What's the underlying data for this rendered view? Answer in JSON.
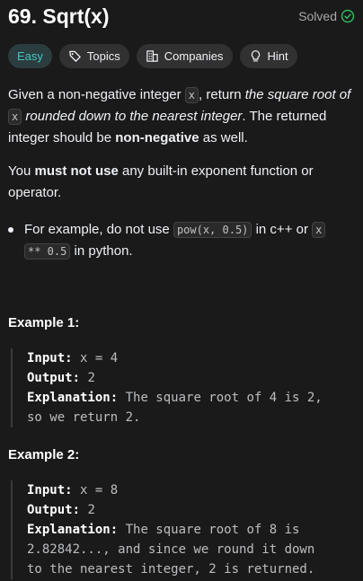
{
  "problem": {
    "title": "69. Sqrt(x)",
    "status": "Solved"
  },
  "tags": {
    "difficulty": "Easy",
    "topics": "Topics",
    "companies": "Companies",
    "hint": "Hint"
  },
  "description": {
    "p1_a": "Given a non-negative integer ",
    "p1_code1": "x",
    "p1_b": ", return ",
    "p1_italic1": "the square root of",
    "p1_code2": "x",
    "p1_italic2": " rounded down to the nearest integer",
    "p1_c": ". The returned integer should be ",
    "p1_bold": "non-negative",
    "p1_d": " as well.",
    "p2_a": "You ",
    "p2_bold": "must not use",
    "p2_b": " any built-in exponent function or operator.",
    "bullet_a": "For example, do not use ",
    "bullet_code1": "pow(x, 0.5)",
    "bullet_b": " in c++ or ",
    "bullet_code2a": "x",
    "bullet_code2b": "** 0.5",
    "bullet_c": " in python."
  },
  "examples": [
    {
      "heading": "Example 1:",
      "input_label": "Input:",
      "input_value": " x = 4",
      "output_label": "Output:",
      "output_value": " 2",
      "explanation_label": "Explanation:",
      "explanation_line1": " The square root of 4 is 2,",
      "explanation_line2": "so we return 2."
    },
    {
      "heading": "Example 2:",
      "input_label": "Input:",
      "input_value": " x = 8",
      "output_label": "Output:",
      "output_value": " 2",
      "explanation_label": "Explanation:",
      "explanation_line1": " The square root of 8 is",
      "explanation_line2": "2.82842..., and since we round it down",
      "explanation_line3": "to the nearest integer, 2 is returned."
    }
  ]
}
